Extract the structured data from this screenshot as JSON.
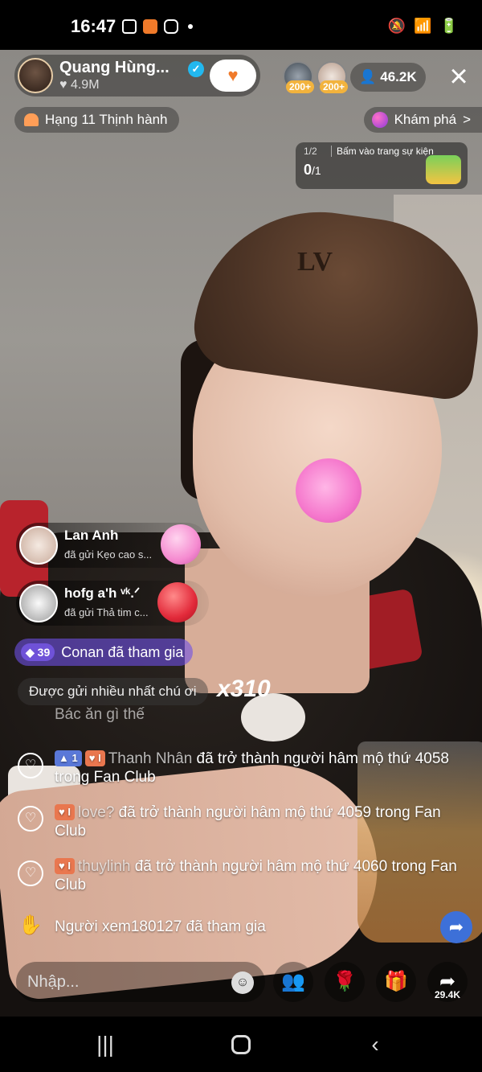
{
  "status_bar": {
    "time": "16:47"
  },
  "host": {
    "name": "Quang Hùng...",
    "likes": "4.9M"
  },
  "viewers": {
    "badge_1": "200+",
    "badge_2": "200+",
    "count": "46.2K"
  },
  "rank": {
    "label": "Hạng 11 Thịnh hành"
  },
  "explore": {
    "label": "Khám phá",
    "chevron": ">"
  },
  "event": {
    "step": "1/2",
    "title": "Bấm vào trang sự kiện",
    "progress_current": "0",
    "progress_total": "/1"
  },
  "gifts": [
    {
      "name": "Lan Anh",
      "sub": "đã gửi Kẹo cao s..."
    },
    {
      "name": "hofg a'h ᵛᵏ.ᐟ",
      "sub": "đã gửi Thả tim c..."
    }
  ],
  "join": {
    "level": "39",
    "text": "Conan đã tham gia"
  },
  "suggestion": "Được gửi nhiều nhất chú ơi",
  "combo": "x310",
  "chat_faded": "Bác ăn gì thế",
  "chat": [
    {
      "tags": [
        "1",
        "I"
      ],
      "user": "Thanh Nhân",
      "text": " đã trở thành người hâm mộ thứ 4058 trong Fan Club"
    },
    {
      "tags": [
        "I"
      ],
      "user": "love?",
      "text": " đã trở thành người hâm mộ thứ 4059 trong Fan Club"
    },
    {
      "tags": [
        "I"
      ],
      "user": "thuylinh",
      "text": " đã trở thành người hâm mộ thứ 4060 trong Fan Club"
    },
    {
      "tags": [],
      "user": "",
      "text": "Người xem180127 đã tham gia"
    }
  ],
  "input": {
    "placeholder": "Nhập..."
  },
  "actions": {
    "share_count": "29.4K"
  },
  "colors": {
    "accent_orange": "#f07a2a",
    "verified_blue": "#22b8ef",
    "join_purple": "#6f52d8"
  }
}
